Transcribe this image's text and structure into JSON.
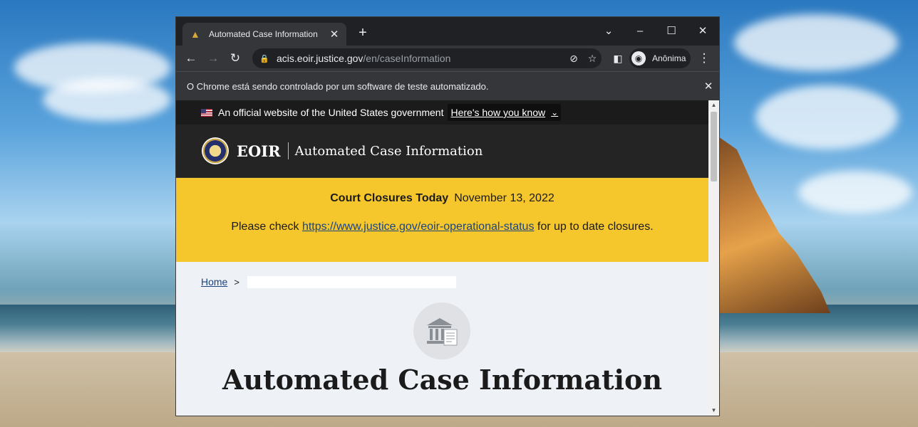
{
  "browser": {
    "tab_title": "Automated Case Information",
    "url_host": "acis.eoir.justice.gov",
    "url_path": "/en/caseInformation",
    "profile_label": "Anônima",
    "infobar_text": "O Chrome está sendo controlado por um software de teste automatizado."
  },
  "gov_banner": {
    "text": "An official website of the United States government",
    "link": "Here's how you know"
  },
  "header": {
    "brand": "EOIR",
    "subtitle": "Automated Case Information"
  },
  "alert": {
    "title": "Court Closures Today",
    "date": "November 13, 2022",
    "prefix": "Please check",
    "link": "https://www.justice.gov/eoir-operational-status",
    "suffix": "for up to date closures."
  },
  "breadcrumb": {
    "home": "Home",
    "separator": ">"
  },
  "main": {
    "title": "Automated Case Information"
  },
  "colors": {
    "alert_bg": "#f6c62d",
    "link": "#1a4480",
    "header_bg": "#242424"
  }
}
